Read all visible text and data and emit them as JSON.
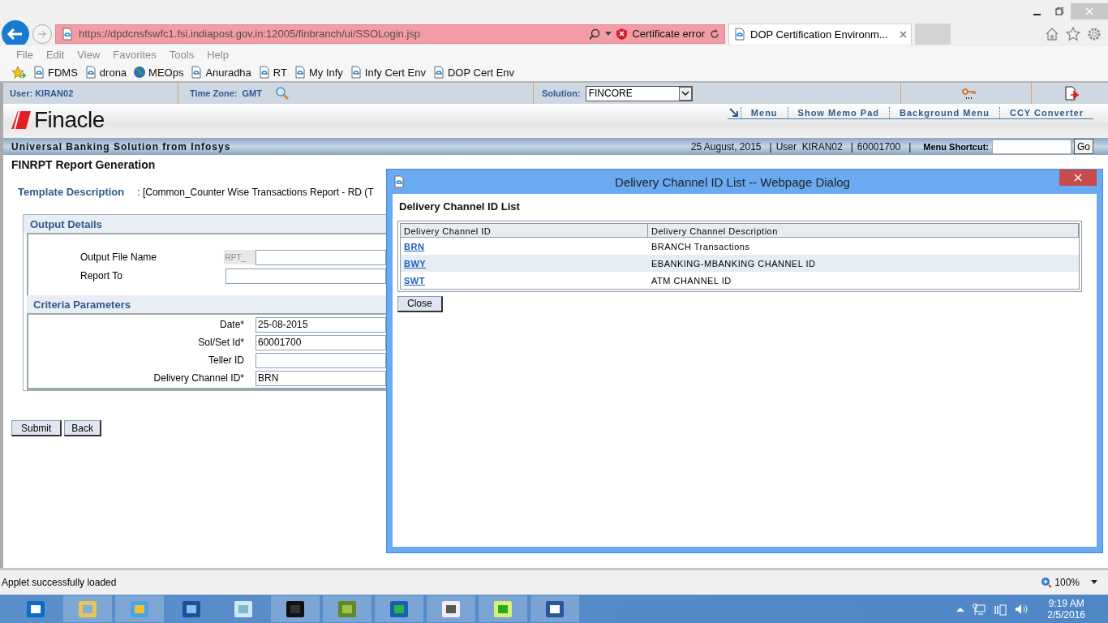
{
  "browser": {
    "url": "https://dpdcnsfswfc1.fsi.indiapost.gov.in:12005/finbranch/ui/SSOLogin.jsp",
    "certificate_error": "Certificate error",
    "tabs": [
      {
        "label": "DOP Certification Environm...",
        "selected": true
      }
    ],
    "menu": [
      "File",
      "Edit",
      "View",
      "Favorites",
      "Tools",
      "Help"
    ],
    "favorites": [
      {
        "label": "FDMS",
        "kind": "page"
      },
      {
        "label": "drona",
        "kind": "page"
      },
      {
        "label": "MEOps",
        "kind": "globe"
      },
      {
        "label": "Anuradha",
        "kind": "page"
      },
      {
        "label": "RT",
        "kind": "page"
      },
      {
        "label": "My Infy",
        "kind": "page"
      },
      {
        "label": "Infy Cert Env",
        "kind": "page"
      },
      {
        "label": "DOP Cert Env",
        "kind": "page"
      }
    ]
  },
  "app": {
    "user": "User: KIRAN02",
    "time_zone_label": "Time Zone:",
    "time_zone": "GMT",
    "solution_label": "Solution:",
    "solution": "FINCORE",
    "logo": "Finacle",
    "nav": [
      "Menu",
      "Show Memo Pad",
      "Background Menu",
      "CCY Converter"
    ],
    "tagline": "Universal Banking Solution from Infosys",
    "date": "25 August, 2015",
    "separators": [
      "|",
      "|",
      "|"
    ],
    "session_user": "User  KIRAN02",
    "sol_id": "60001700",
    "menu_shortcut_label": "Menu Shortcut:",
    "go_button": "Go"
  },
  "page": {
    "title": "FINRPT Report Generation",
    "template_label": "Template Description",
    "template_value": ": [Common_Counter Wise Transactions Report - RD (T",
    "output_details": {
      "title": "Output Details",
      "file_name_label": "Output File Name",
      "file_prefix": "RPT_",
      "report_to_label": "Report To"
    },
    "criteria": {
      "title": "Criteria Parameters",
      "fields": [
        {
          "label": "Date*",
          "value": "25-08-2015"
        },
        {
          "label": "Sol/Set Id*",
          "value": "60001700"
        },
        {
          "label": "Teller ID"
        },
        {
          "label": "Delivery Channel ID*",
          "value": "BRN"
        }
      ]
    },
    "buttons": [
      "Submit",
      "Back"
    ]
  },
  "dialog": {
    "title": "Delivery Channel ID List -- Webpage Dialog",
    "heading": "Delivery Channel ID List",
    "columns": [
      "Delivery Channel ID",
      "Delivery Channel Description"
    ],
    "rows": [
      {
        "id": "BRN",
        "description": "BRANCH Transactions"
      },
      {
        "id": "BWY",
        "description": "EBANKING-MBANKING CHANNEL ID"
      },
      {
        "id": "SWT",
        "description": "ATM CHANNEL ID"
      }
    ],
    "close_button": "Close"
  },
  "status_bar": {
    "message": "Applet successfully loaded",
    "zoom": "100%"
  },
  "taskbar": {
    "time": "9:19 AM",
    "date": "2/5/2016"
  }
}
